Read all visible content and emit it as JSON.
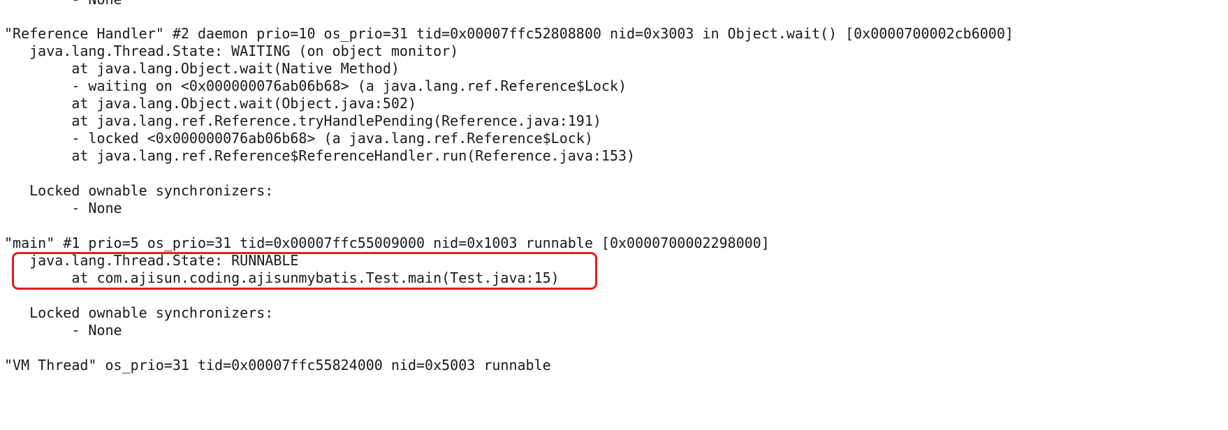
{
  "terminal": {
    "highlight_color": "#e61a1a",
    "text_color": "#1a1a1a",
    "background": "#ffffff",
    "lines": [
      "        - None",
      "",
      "\"Reference Handler\" #2 daemon prio=10 os_prio=31 tid=0x00007ffc52808800 nid=0x3003 in Object.wait() [0x0000700002cb6000]",
      "   java.lang.Thread.State: WAITING (on object monitor)",
      "        at java.lang.Object.wait(Native Method)",
      "        - waiting on <0x000000076ab06b68> (a java.lang.ref.Reference$Lock)",
      "        at java.lang.Object.wait(Object.java:502)",
      "        at java.lang.ref.Reference.tryHandlePending(Reference.java:191)",
      "        - locked <0x000000076ab06b68> (a java.lang.ref.Reference$Lock)",
      "        at java.lang.ref.Reference$ReferenceHandler.run(Reference.java:153)",
      "",
      "   Locked ownable synchronizers:",
      "        - None",
      "",
      "\"main\" #1 prio=5 os_prio=31 tid=0x00007ffc55009000 nid=0x1003 runnable [0x0000700002298000]",
      "   java.lang.Thread.State: RUNNABLE",
      "        at com.ajisun.coding.ajisunmybatis.Test.main(Test.java:15)",
      "",
      "   Locked ownable synchronizers:",
      "        - None",
      "",
      "\"VM Thread\" os_prio=31 tid=0x00007ffc55824000 nid=0x5003 runnable"
    ]
  }
}
